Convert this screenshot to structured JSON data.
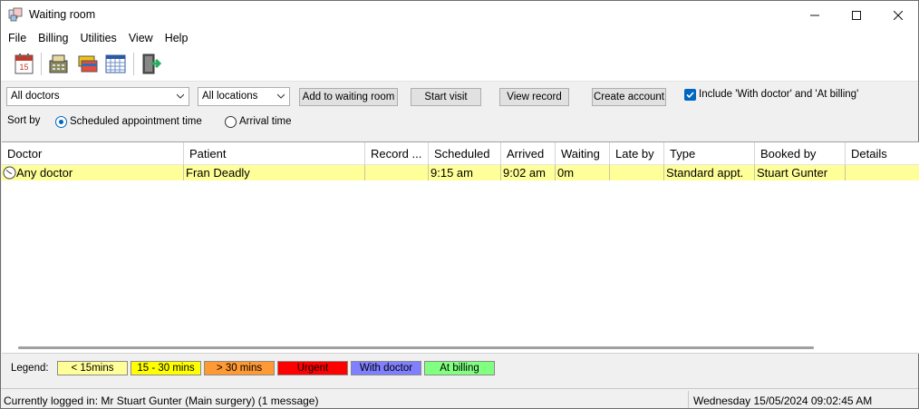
{
  "window": {
    "title": "Waiting room",
    "controls": {
      "minimize": "—",
      "maximize": "☐",
      "close": "✕"
    }
  },
  "menu": [
    "File",
    "Billing",
    "Utilities",
    "View",
    "Help"
  ],
  "toolbar": {
    "icons": [
      "calendar-icon",
      "cash-register-icon",
      "cards-icon",
      "schedule-grid-icon",
      "exit-door-icon"
    ]
  },
  "filters": {
    "doctor": "All doctors",
    "location": "All locations",
    "add_to_waiting_room": "Add to waiting room",
    "start_visit": "Start visit",
    "view_record": "View record",
    "create_account": "Create account",
    "include_label": "Include 'With doctor' and 'At billing'",
    "include_checked": true
  },
  "sort": {
    "label": "Sort by",
    "scheduled": "Scheduled appointment time",
    "arrival": "Arrival time",
    "selected": "scheduled"
  },
  "grid": {
    "columns": [
      "Doctor",
      "Patient",
      "Record ...",
      "Scheduled",
      "Arrived",
      "Waiting",
      "Late by",
      "Type",
      "Booked by",
      "Details"
    ],
    "rows": [
      {
        "doctor": "Any doctor",
        "patient": "Fran Deadly",
        "record": "",
        "scheduled": "9:15 am",
        "arrived": "9:02 am",
        "waiting": "0m",
        "late_by": "",
        "type": "Standard appt.",
        "booked_by": "Stuart Gunter",
        "details": "",
        "row_color": "#ffff99"
      }
    ]
  },
  "legend": {
    "label": "Legend:",
    "items": [
      {
        "label": "< 15mins",
        "color": "#ffff99"
      },
      {
        "label": "15 - 30 mins",
        "color": "#ffff00"
      },
      {
        "label": "> 30 mins",
        "color": "#ff9933"
      },
      {
        "label": "Urgent",
        "color": "#ff0000"
      },
      {
        "label": "With doctor",
        "color": "#8080ff"
      },
      {
        "label": "At billing",
        "color": "#80ff80"
      }
    ]
  },
  "status": {
    "logged_in": "Currently logged in:  Mr Stuart Gunter (Main surgery) (1 message)",
    "datetime": "Wednesday 15/05/2024 09:02:45 AM"
  }
}
